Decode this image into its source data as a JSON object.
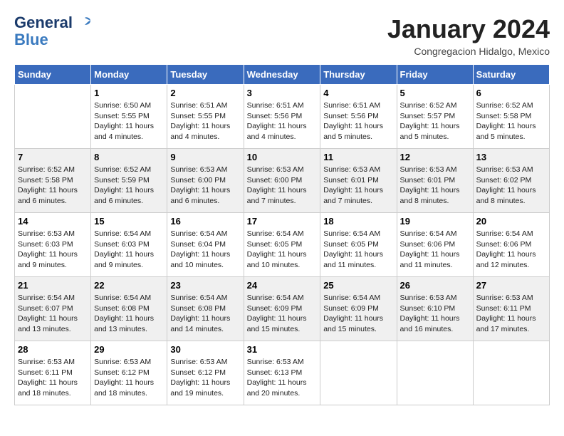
{
  "header": {
    "logo_line1": "General",
    "logo_line2": "Blue",
    "month": "January 2024",
    "location": "Congregacion Hidalgo, Mexico"
  },
  "weekdays": [
    "Sunday",
    "Monday",
    "Tuesday",
    "Wednesday",
    "Thursday",
    "Friday",
    "Saturday"
  ],
  "weeks": [
    [
      {
        "day": "",
        "info": ""
      },
      {
        "day": "1",
        "info": "Sunrise: 6:50 AM\nSunset: 5:55 PM\nDaylight: 11 hours\nand 4 minutes."
      },
      {
        "day": "2",
        "info": "Sunrise: 6:51 AM\nSunset: 5:55 PM\nDaylight: 11 hours\nand 4 minutes."
      },
      {
        "day": "3",
        "info": "Sunrise: 6:51 AM\nSunset: 5:56 PM\nDaylight: 11 hours\nand 4 minutes."
      },
      {
        "day": "4",
        "info": "Sunrise: 6:51 AM\nSunset: 5:56 PM\nDaylight: 11 hours\nand 5 minutes."
      },
      {
        "day": "5",
        "info": "Sunrise: 6:52 AM\nSunset: 5:57 PM\nDaylight: 11 hours\nand 5 minutes."
      },
      {
        "day": "6",
        "info": "Sunrise: 6:52 AM\nSunset: 5:58 PM\nDaylight: 11 hours\nand 5 minutes."
      }
    ],
    [
      {
        "day": "7",
        "info": "Sunrise: 6:52 AM\nSunset: 5:58 PM\nDaylight: 11 hours\nand 6 minutes."
      },
      {
        "day": "8",
        "info": "Sunrise: 6:52 AM\nSunset: 5:59 PM\nDaylight: 11 hours\nand 6 minutes."
      },
      {
        "day": "9",
        "info": "Sunrise: 6:53 AM\nSunset: 6:00 PM\nDaylight: 11 hours\nand 6 minutes."
      },
      {
        "day": "10",
        "info": "Sunrise: 6:53 AM\nSunset: 6:00 PM\nDaylight: 11 hours\nand 7 minutes."
      },
      {
        "day": "11",
        "info": "Sunrise: 6:53 AM\nSunset: 6:01 PM\nDaylight: 11 hours\nand 7 minutes."
      },
      {
        "day": "12",
        "info": "Sunrise: 6:53 AM\nSunset: 6:01 PM\nDaylight: 11 hours\nand 8 minutes."
      },
      {
        "day": "13",
        "info": "Sunrise: 6:53 AM\nSunset: 6:02 PM\nDaylight: 11 hours\nand 8 minutes."
      }
    ],
    [
      {
        "day": "14",
        "info": "Sunrise: 6:53 AM\nSunset: 6:03 PM\nDaylight: 11 hours\nand 9 minutes."
      },
      {
        "day": "15",
        "info": "Sunrise: 6:54 AM\nSunset: 6:03 PM\nDaylight: 11 hours\nand 9 minutes."
      },
      {
        "day": "16",
        "info": "Sunrise: 6:54 AM\nSunset: 6:04 PM\nDaylight: 11 hours\nand 10 minutes."
      },
      {
        "day": "17",
        "info": "Sunrise: 6:54 AM\nSunset: 6:05 PM\nDaylight: 11 hours\nand 10 minutes."
      },
      {
        "day": "18",
        "info": "Sunrise: 6:54 AM\nSunset: 6:05 PM\nDaylight: 11 hours\nand 11 minutes."
      },
      {
        "day": "19",
        "info": "Sunrise: 6:54 AM\nSunset: 6:06 PM\nDaylight: 11 hours\nand 11 minutes."
      },
      {
        "day": "20",
        "info": "Sunrise: 6:54 AM\nSunset: 6:06 PM\nDaylight: 11 hours\nand 12 minutes."
      }
    ],
    [
      {
        "day": "21",
        "info": "Sunrise: 6:54 AM\nSunset: 6:07 PM\nDaylight: 11 hours\nand 13 minutes."
      },
      {
        "day": "22",
        "info": "Sunrise: 6:54 AM\nSunset: 6:08 PM\nDaylight: 11 hours\nand 13 minutes."
      },
      {
        "day": "23",
        "info": "Sunrise: 6:54 AM\nSunset: 6:08 PM\nDaylight: 11 hours\nand 14 minutes."
      },
      {
        "day": "24",
        "info": "Sunrise: 6:54 AM\nSunset: 6:09 PM\nDaylight: 11 hours\nand 15 minutes."
      },
      {
        "day": "25",
        "info": "Sunrise: 6:54 AM\nSunset: 6:09 PM\nDaylight: 11 hours\nand 15 minutes."
      },
      {
        "day": "26",
        "info": "Sunrise: 6:53 AM\nSunset: 6:10 PM\nDaylight: 11 hours\nand 16 minutes."
      },
      {
        "day": "27",
        "info": "Sunrise: 6:53 AM\nSunset: 6:11 PM\nDaylight: 11 hours\nand 17 minutes."
      }
    ],
    [
      {
        "day": "28",
        "info": "Sunrise: 6:53 AM\nSunset: 6:11 PM\nDaylight: 11 hours\nand 18 minutes."
      },
      {
        "day": "29",
        "info": "Sunrise: 6:53 AM\nSunset: 6:12 PM\nDaylight: 11 hours\nand 18 minutes."
      },
      {
        "day": "30",
        "info": "Sunrise: 6:53 AM\nSunset: 6:12 PM\nDaylight: 11 hours\nand 19 minutes."
      },
      {
        "day": "31",
        "info": "Sunrise: 6:53 AM\nSunset: 6:13 PM\nDaylight: 11 hours\nand 20 minutes."
      },
      {
        "day": "",
        "info": ""
      },
      {
        "day": "",
        "info": ""
      },
      {
        "day": "",
        "info": ""
      }
    ]
  ]
}
